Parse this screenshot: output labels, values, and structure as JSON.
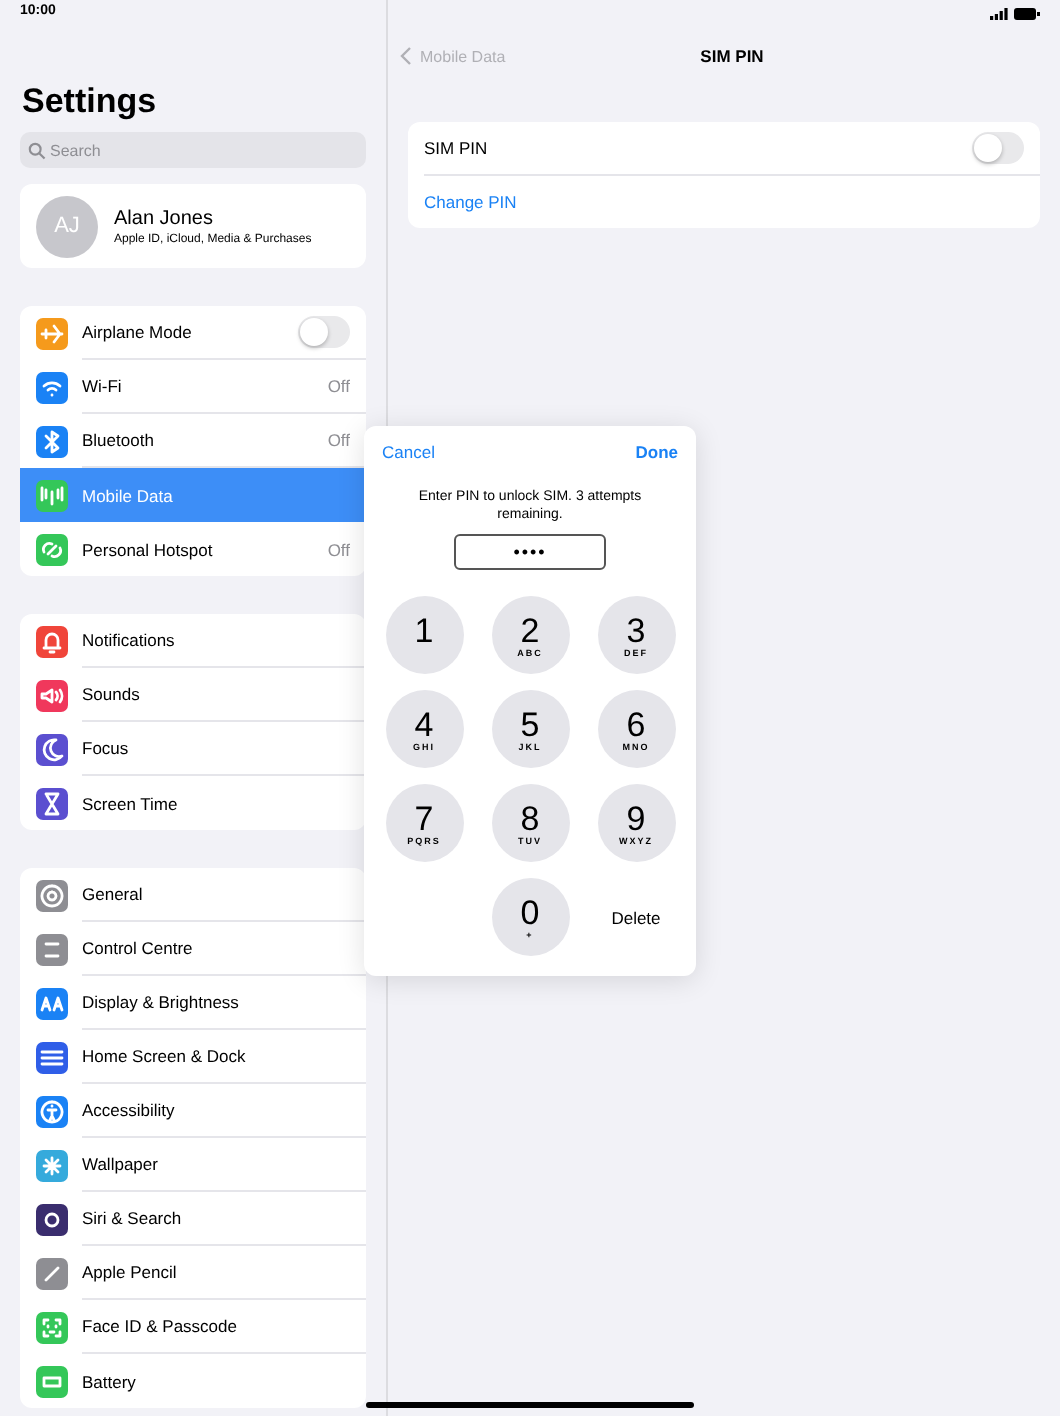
{
  "status_bar": {
    "time": "10:00"
  },
  "sidebar": {
    "title": "Settings",
    "search": {
      "placeholder": "Search"
    },
    "profile": {
      "initials": "AJ",
      "name": "Alan Jones",
      "subtitle": "Apple ID, iCloud, Media & Purchases"
    },
    "groups": [
      {
        "items": [
          {
            "label": "Airplane Mode",
            "kind": "toggle",
            "on": false,
            "selected": false
          },
          {
            "label": "Wi-Fi",
            "kind": "value",
            "value": "Off",
            "selected": false
          },
          {
            "label": "Bluetooth",
            "kind": "value",
            "value": "Off",
            "selected": false
          },
          {
            "label": "Mobile Data",
            "kind": "plain",
            "selected": true
          },
          {
            "label": "Personal Hotspot",
            "kind": "value",
            "value": "Off",
            "selected": false
          }
        ]
      },
      {
        "items": [
          {
            "label": "Notifications",
            "kind": "plain",
            "selected": false
          },
          {
            "label": "Sounds",
            "kind": "plain",
            "selected": false
          },
          {
            "label": "Focus",
            "kind": "plain",
            "selected": false
          },
          {
            "label": "Screen Time",
            "kind": "plain",
            "selected": false
          }
        ]
      },
      {
        "items": [
          {
            "label": "General",
            "kind": "plain",
            "selected": false
          },
          {
            "label": "Control Centre",
            "kind": "plain",
            "selected": false
          },
          {
            "label": "Display & Brightness",
            "kind": "plain",
            "selected": false
          },
          {
            "label": "Home Screen & Dock",
            "kind": "plain",
            "selected": false
          },
          {
            "label": "Accessibility",
            "kind": "plain",
            "selected": false
          },
          {
            "label": "Wallpaper",
            "kind": "plain",
            "selected": false
          },
          {
            "label": "Siri & Search",
            "kind": "plain",
            "selected": false
          },
          {
            "label": "Apple Pencil",
            "kind": "plain",
            "selected": false
          },
          {
            "label": "Face ID & Passcode",
            "kind": "plain",
            "selected": false
          },
          {
            "label": "Battery",
            "kind": "plain",
            "selected": false
          }
        ]
      }
    ]
  },
  "detail": {
    "back": "Mobile Data",
    "title": "SIM PIN",
    "rows": [
      {
        "kind": "toggle",
        "label": "SIM PIN",
        "on": false
      },
      {
        "kind": "link",
        "label": "Change PIN"
      }
    ]
  },
  "pin_dialog": {
    "cancel": "Cancel",
    "done": "Done",
    "message": "Enter PIN to unlock SIM. 3 attempts remaining.",
    "value": "••••",
    "keys": [
      {
        "digit": "1"
      },
      {
        "digit": "2",
        "letters": "ABC"
      },
      {
        "digit": "3",
        "letters": "DEF"
      },
      {
        "digit": "4",
        "letters": "GHI"
      },
      {
        "digit": "5",
        "letters": "JKL"
      },
      {
        "digit": "6",
        "letters": "MNO"
      },
      {
        "digit": "7",
        "letters": "PQRS"
      },
      {
        "digit": "8",
        "letters": "TUV"
      },
      {
        "digit": "9",
        "letters": "WXYZ"
      },
      {
        "digit": "0",
        "letters": "+"
      }
    ],
    "delete": "Delete"
  }
}
